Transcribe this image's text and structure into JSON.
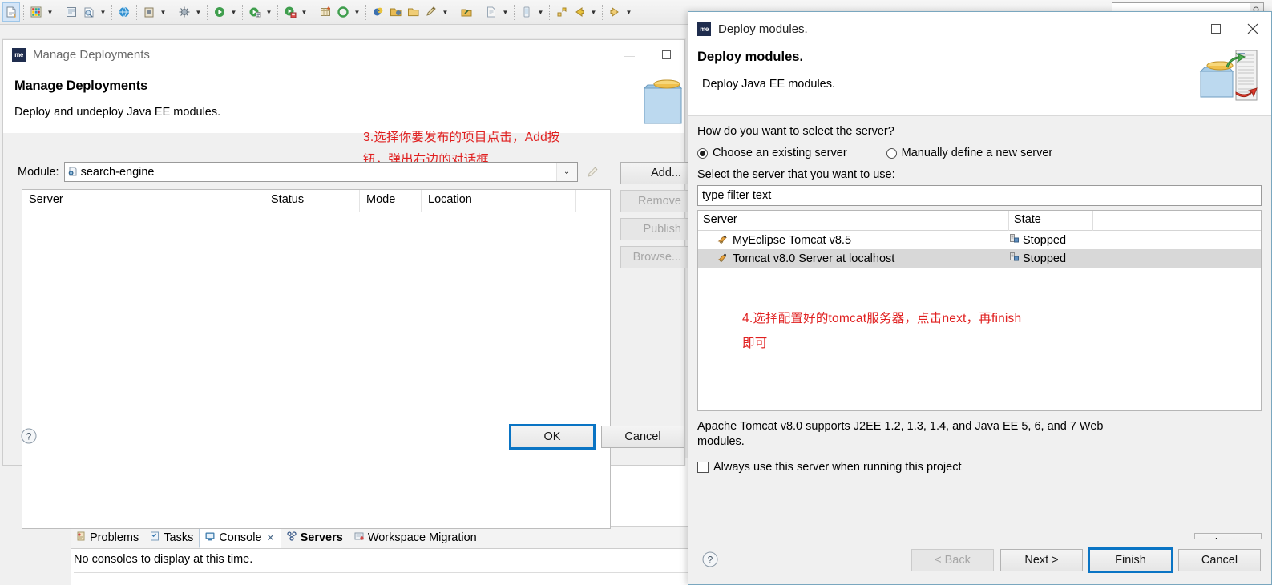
{
  "ide": {
    "toolbar_items": [
      {
        "name": "new-wizard-icon",
        "selected": true
      },
      {
        "name": "new-project-grid-icon",
        "dropdown": true
      },
      {
        "name": "new-class-icon",
        "dropdown": false
      },
      {
        "name": "inspect-icon",
        "dropdown": true
      },
      {
        "name": "globe-icon",
        "dropdown": false
      },
      {
        "name": "snapshot-icon",
        "dropdown": true
      },
      {
        "name": "debug-bug-icon",
        "dropdown": true
      },
      {
        "name": "run-icon",
        "dropdown": true
      },
      {
        "name": "run-config-icon",
        "dropdown": true
      },
      {
        "name": "run-server-icon",
        "dropdown": true
      },
      {
        "name": "new-ee-project-icon",
        "dropdown": false
      },
      {
        "name": "refresh-icon",
        "dropdown": true
      },
      {
        "name": "open-perspective-icon",
        "dropdown": false
      },
      {
        "name": "open-folder-icon",
        "dropdown": false
      },
      {
        "name": "open-type-icon",
        "dropdown": false
      },
      {
        "name": "search-pencil-icon",
        "dropdown": true
      },
      {
        "name": "deploy-icon",
        "dropdown": false
      },
      {
        "name": "page-icon",
        "dropdown": true
      },
      {
        "name": "mobile-icon",
        "dropdown": true
      },
      {
        "name": "previous-annotation-icon",
        "dropdown": false
      },
      {
        "name": "back-icon",
        "dropdown": true
      },
      {
        "name": "forward-icon",
        "dropdown": true
      }
    ],
    "search_placeholder": "",
    "bottom_tabs": [
      {
        "label": "Problems",
        "icon": "problems-icon",
        "active": false,
        "bold": false
      },
      {
        "label": "Tasks",
        "icon": "tasks-icon",
        "active": false,
        "bold": false
      },
      {
        "label": "Console",
        "icon": "console-icon",
        "active": true,
        "bold": false,
        "closable": true
      },
      {
        "label": "Servers",
        "icon": "servers-icon",
        "active": false,
        "bold": true
      },
      {
        "label": "Workspace Migration",
        "icon": "migration-icon",
        "active": false,
        "bold": false
      }
    ],
    "console_message": "No consoles to display at this time."
  },
  "manage_deployments": {
    "window_title": "Manage Deployments",
    "heading": "Manage Deployments",
    "subheading": "Deploy and undeploy Java EE modules.",
    "annotation": "3.选择你要发布的项目点击，Add按\n钮，弹出右边的对话框",
    "module_label": "Module:",
    "module_value": "search-engine",
    "module_icon": "war-module-icon",
    "table_headers": [
      "Server",
      "Status",
      "Mode",
      "Location"
    ],
    "table_rows": [],
    "side_buttons": [
      {
        "label": "Add...",
        "enabled": true
      },
      {
        "label": "Remove",
        "enabled": false
      },
      {
        "label": "Publish",
        "enabled": false
      },
      {
        "label": "Browse...",
        "enabled": false
      }
    ],
    "footer_buttons": [
      {
        "label": "OK",
        "enabled": true,
        "focused": true
      },
      {
        "label": "Cancel",
        "enabled": true,
        "focused": false
      }
    ],
    "help_icon": "help-icon",
    "window_controls": [
      "minimize",
      "maximize"
    ]
  },
  "deploy_modules": {
    "window_title": "Deploy modules.",
    "heading": "Deploy modules.",
    "subheading": "Deploy Java EE modules.",
    "question": "How do you want to select the server?",
    "radios": [
      {
        "label": "Choose an existing server",
        "selected": true
      },
      {
        "label": "Manually define a new server",
        "selected": false
      }
    ],
    "select_label": "Select the server that you want to use:",
    "filter_value": "type filter text",
    "list_headers": [
      "Server",
      "State"
    ],
    "list_rows": [
      {
        "server": "MyEclipse Tomcat v8.5",
        "state": "Stopped",
        "selected": false
      },
      {
        "server": "Tomcat v8.0 Server at localhost",
        "state": "Stopped",
        "selected": true
      }
    ],
    "annotation": "4.选择配置好的tomcat服务器，点击next，再finish\n即可",
    "description": "Apache Tomcat v8.0 supports J2EE 1.2, 1.3, 1.4, and Java EE 5, 6, and 7 Web modules.",
    "columns_button": "Columns...",
    "checkbox": {
      "label": "Always use this server when running this project",
      "checked": false
    },
    "footer_buttons": [
      {
        "label": "< Back",
        "enabled": false,
        "focused": false
      },
      {
        "label": "Next >",
        "enabled": true,
        "focused": false
      },
      {
        "label": "Finish",
        "enabled": true,
        "focused": true
      },
      {
        "label": "Cancel",
        "enabled": true,
        "focused": false
      }
    ],
    "help_icon": "help-icon",
    "window_controls": [
      "minimize",
      "maximize",
      "close"
    ]
  },
  "colors": {
    "annotation_red": "#e02020",
    "focus_blue": "#0a74c4",
    "dialog_bg": "#f0f0f0",
    "selection_grey": "#d8d8d8",
    "title_grey": "#6b6b6b"
  }
}
